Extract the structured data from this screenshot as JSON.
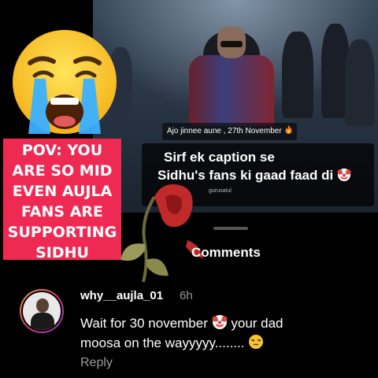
{
  "video": {
    "date_label": "Ajo jinnee aune , 27th November",
    "caption_line1": "Sirf ek caption se",
    "caption_line2": "Sidhu's fans ki gaad faad di",
    "handle": "gurusatul"
  },
  "meme": {
    "pov_lines": [
      "POV: YOU",
      "ARE SO MID",
      "EVEN AUJLA",
      "FANS ARE",
      "SUPPORTING",
      "SIDHU"
    ],
    "pov_bg": "#ee2a53"
  },
  "comments": {
    "title": "Comments",
    "items": [
      {
        "username": "why__aujla_01",
        "time": "6h",
        "text_part1": "Wait for 30 november",
        "text_part2": "your dad",
        "text_part3": "moosa on the wayyyyy........",
        "reply_label": "Reply"
      }
    ]
  },
  "icons": [
    "loudly-crying-face-icon",
    "wilted-rose-icon",
    "fire-icon",
    "clown-face-icon",
    "unamused-face-icon"
  ]
}
